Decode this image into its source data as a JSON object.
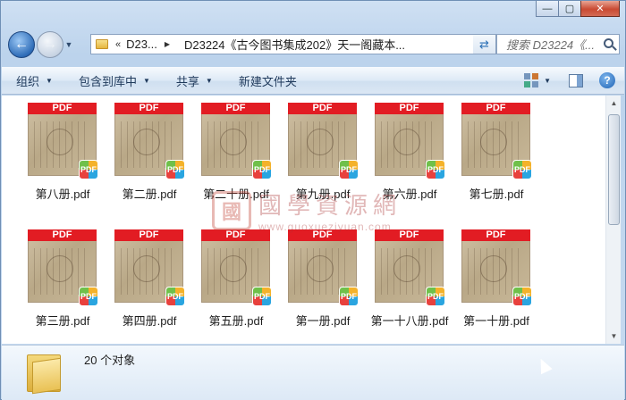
{
  "window": {
    "caption": {
      "minimize": "—",
      "maximize": "▢",
      "close": "✕"
    }
  },
  "address": {
    "chevron": "«",
    "crumb1": "D23...",
    "crumb2": "D23224《古今图书集成202》天一阁藏本...",
    "refresh_icon": "refresh-icon"
  },
  "search": {
    "placeholder": "搜索 D23224《..."
  },
  "toolbar": {
    "organize": "组织",
    "include_library": "包含到库中",
    "share": "共享",
    "new_folder": "新建文件夹"
  },
  "files": [
    {
      "name": "第八册.pdf",
      "pdf_label": "PDF",
      "badge": "PDF"
    },
    {
      "name": "第二册.pdf",
      "pdf_label": "PDF",
      "badge": "PDF"
    },
    {
      "name": "第二十册.pdf",
      "pdf_label": "PDF",
      "badge": "PDF"
    },
    {
      "name": "第九册.pdf",
      "pdf_label": "PDF",
      "badge": "PDF"
    },
    {
      "name": "第六册.pdf",
      "pdf_label": "PDF",
      "badge": "PDF"
    },
    {
      "name": "第七册.pdf",
      "pdf_label": "PDF",
      "badge": "PDF"
    },
    {
      "name": "第三册.pdf",
      "pdf_label": "PDF",
      "badge": "PDF"
    },
    {
      "name": "第四册.pdf",
      "pdf_label": "PDF",
      "badge": "PDF"
    },
    {
      "name": "第五册.pdf",
      "pdf_label": "PDF",
      "badge": "PDF"
    },
    {
      "name": "第一册.pdf",
      "pdf_label": "PDF",
      "badge": "PDF"
    },
    {
      "name": "第一十八册.pdf",
      "pdf_label": "PDF",
      "badge": "PDF"
    },
    {
      "name": "第一十册.pdf",
      "pdf_label": "PDF",
      "badge": "PDF"
    }
  ],
  "watermark": {
    "seal": "國",
    "text": "國學資源網",
    "url": "www.guoxueziyuan.com"
  },
  "status": {
    "count": "20 个对象"
  }
}
